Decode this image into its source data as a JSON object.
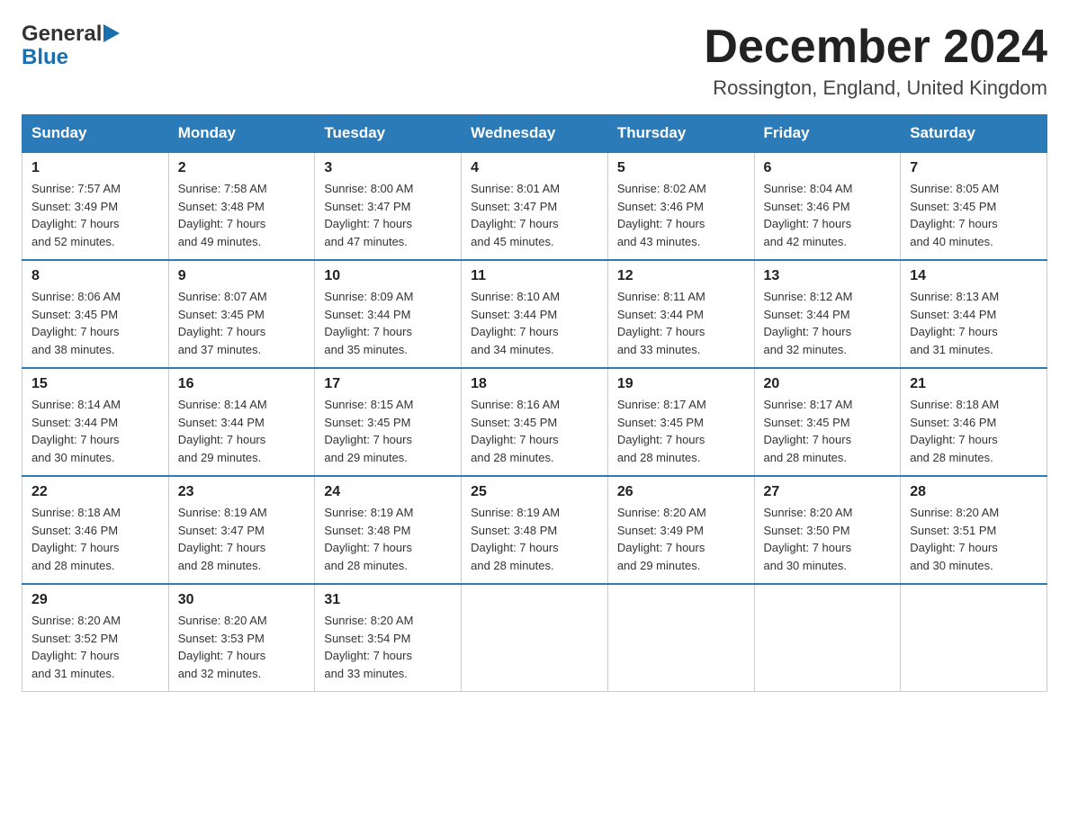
{
  "logo": {
    "general": "General",
    "blue": "Blue"
  },
  "title": "December 2024",
  "subtitle": "Rossington, England, United Kingdom",
  "days": [
    "Sunday",
    "Monday",
    "Tuesday",
    "Wednesday",
    "Thursday",
    "Friday",
    "Saturday"
  ],
  "weeks": [
    [
      {
        "day": "1",
        "sunrise": "7:57 AM",
        "sunset": "3:49 PM",
        "daylight": "7 hours and 52 minutes."
      },
      {
        "day": "2",
        "sunrise": "7:58 AM",
        "sunset": "3:48 PM",
        "daylight": "7 hours and 49 minutes."
      },
      {
        "day": "3",
        "sunrise": "8:00 AM",
        "sunset": "3:47 PM",
        "daylight": "7 hours and 47 minutes."
      },
      {
        "day": "4",
        "sunrise": "8:01 AM",
        "sunset": "3:47 PM",
        "daylight": "7 hours and 45 minutes."
      },
      {
        "day": "5",
        "sunrise": "8:02 AM",
        "sunset": "3:46 PM",
        "daylight": "7 hours and 43 minutes."
      },
      {
        "day": "6",
        "sunrise": "8:04 AM",
        "sunset": "3:46 PM",
        "daylight": "7 hours and 42 minutes."
      },
      {
        "day": "7",
        "sunrise": "8:05 AM",
        "sunset": "3:45 PM",
        "daylight": "7 hours and 40 minutes."
      }
    ],
    [
      {
        "day": "8",
        "sunrise": "8:06 AM",
        "sunset": "3:45 PM",
        "daylight": "7 hours and 38 minutes."
      },
      {
        "day": "9",
        "sunrise": "8:07 AM",
        "sunset": "3:45 PM",
        "daylight": "7 hours and 37 minutes."
      },
      {
        "day": "10",
        "sunrise": "8:09 AM",
        "sunset": "3:44 PM",
        "daylight": "7 hours and 35 minutes."
      },
      {
        "day": "11",
        "sunrise": "8:10 AM",
        "sunset": "3:44 PM",
        "daylight": "7 hours and 34 minutes."
      },
      {
        "day": "12",
        "sunrise": "8:11 AM",
        "sunset": "3:44 PM",
        "daylight": "7 hours and 33 minutes."
      },
      {
        "day": "13",
        "sunrise": "8:12 AM",
        "sunset": "3:44 PM",
        "daylight": "7 hours and 32 minutes."
      },
      {
        "day": "14",
        "sunrise": "8:13 AM",
        "sunset": "3:44 PM",
        "daylight": "7 hours and 31 minutes."
      }
    ],
    [
      {
        "day": "15",
        "sunrise": "8:14 AM",
        "sunset": "3:44 PM",
        "daylight": "7 hours and 30 minutes."
      },
      {
        "day": "16",
        "sunrise": "8:14 AM",
        "sunset": "3:44 PM",
        "daylight": "7 hours and 29 minutes."
      },
      {
        "day": "17",
        "sunrise": "8:15 AM",
        "sunset": "3:45 PM",
        "daylight": "7 hours and 29 minutes."
      },
      {
        "day": "18",
        "sunrise": "8:16 AM",
        "sunset": "3:45 PM",
        "daylight": "7 hours and 28 minutes."
      },
      {
        "day": "19",
        "sunrise": "8:17 AM",
        "sunset": "3:45 PM",
        "daylight": "7 hours and 28 minutes."
      },
      {
        "day": "20",
        "sunrise": "8:17 AM",
        "sunset": "3:45 PM",
        "daylight": "7 hours and 28 minutes."
      },
      {
        "day": "21",
        "sunrise": "8:18 AM",
        "sunset": "3:46 PM",
        "daylight": "7 hours and 28 minutes."
      }
    ],
    [
      {
        "day": "22",
        "sunrise": "8:18 AM",
        "sunset": "3:46 PM",
        "daylight": "7 hours and 28 minutes."
      },
      {
        "day": "23",
        "sunrise": "8:19 AM",
        "sunset": "3:47 PM",
        "daylight": "7 hours and 28 minutes."
      },
      {
        "day": "24",
        "sunrise": "8:19 AM",
        "sunset": "3:48 PM",
        "daylight": "7 hours and 28 minutes."
      },
      {
        "day": "25",
        "sunrise": "8:19 AM",
        "sunset": "3:48 PM",
        "daylight": "7 hours and 28 minutes."
      },
      {
        "day": "26",
        "sunrise": "8:20 AM",
        "sunset": "3:49 PM",
        "daylight": "7 hours and 29 minutes."
      },
      {
        "day": "27",
        "sunrise": "8:20 AM",
        "sunset": "3:50 PM",
        "daylight": "7 hours and 30 minutes."
      },
      {
        "day": "28",
        "sunrise": "8:20 AM",
        "sunset": "3:51 PM",
        "daylight": "7 hours and 30 minutes."
      }
    ],
    [
      {
        "day": "29",
        "sunrise": "8:20 AM",
        "sunset": "3:52 PM",
        "daylight": "7 hours and 31 minutes."
      },
      {
        "day": "30",
        "sunrise": "8:20 AM",
        "sunset": "3:53 PM",
        "daylight": "7 hours and 32 minutes."
      },
      {
        "day": "31",
        "sunrise": "8:20 AM",
        "sunset": "3:54 PM",
        "daylight": "7 hours and 33 minutes."
      },
      null,
      null,
      null,
      null
    ]
  ],
  "labels": {
    "sunrise": "Sunrise:",
    "sunset": "Sunset:",
    "daylight": "Daylight:"
  }
}
